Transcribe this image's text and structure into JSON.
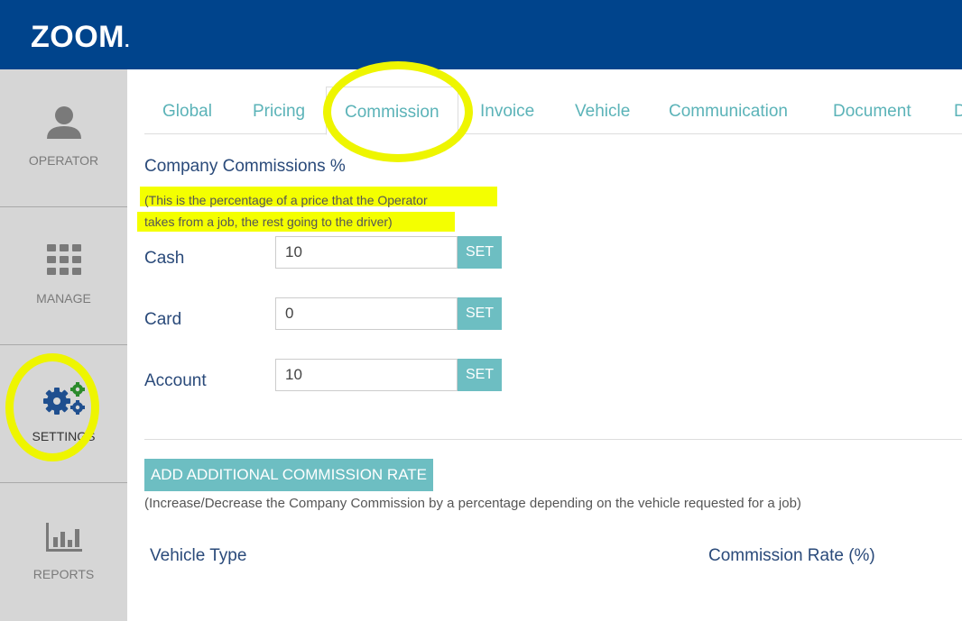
{
  "app": {
    "logo_text": "ZOOM",
    "logo_dot": "."
  },
  "colors": {
    "header_bg": "#00448c",
    "accent": "#6dbec2",
    "sidebar_bg": "#d6d6d6",
    "highlight": "#f4ff00"
  },
  "sidebar": {
    "items": [
      {
        "label": "OPERATOR",
        "icon": "user-icon"
      },
      {
        "label": "MANAGE",
        "icon": "grid-icon"
      },
      {
        "label": "SETTINGS",
        "icon": "gears-icon",
        "active": true
      },
      {
        "label": "REPORTS",
        "icon": "bar-chart-icon"
      }
    ]
  },
  "tabs": [
    {
      "label": "Global"
    },
    {
      "label": "Pricing"
    },
    {
      "label": "Commission",
      "active": true
    },
    {
      "label": "Invoice"
    },
    {
      "label": "Vehicle"
    },
    {
      "label": "Communication"
    },
    {
      "label": "Document"
    },
    {
      "label": "D"
    }
  ],
  "commissions": {
    "title": "Company Commissions %",
    "note_line1": "(This is the percentage of a price that the Operator",
    "note_line2": "takes from a job, the rest going to the driver)",
    "rows": [
      {
        "label": "Cash",
        "value": "10",
        "button": "SET"
      },
      {
        "label": "Card",
        "value": "0",
        "button": "SET"
      },
      {
        "label": "Account",
        "value": "10",
        "button": "SET"
      }
    ]
  },
  "additional": {
    "button": "ADD ADDITIONAL COMMISSION RATE",
    "note": "(Increase/Decrease the Company Commission by a percentage depending on the vehicle requested for a job)",
    "columns": [
      "Vehicle Type",
      "Commission Rate (%)"
    ]
  }
}
